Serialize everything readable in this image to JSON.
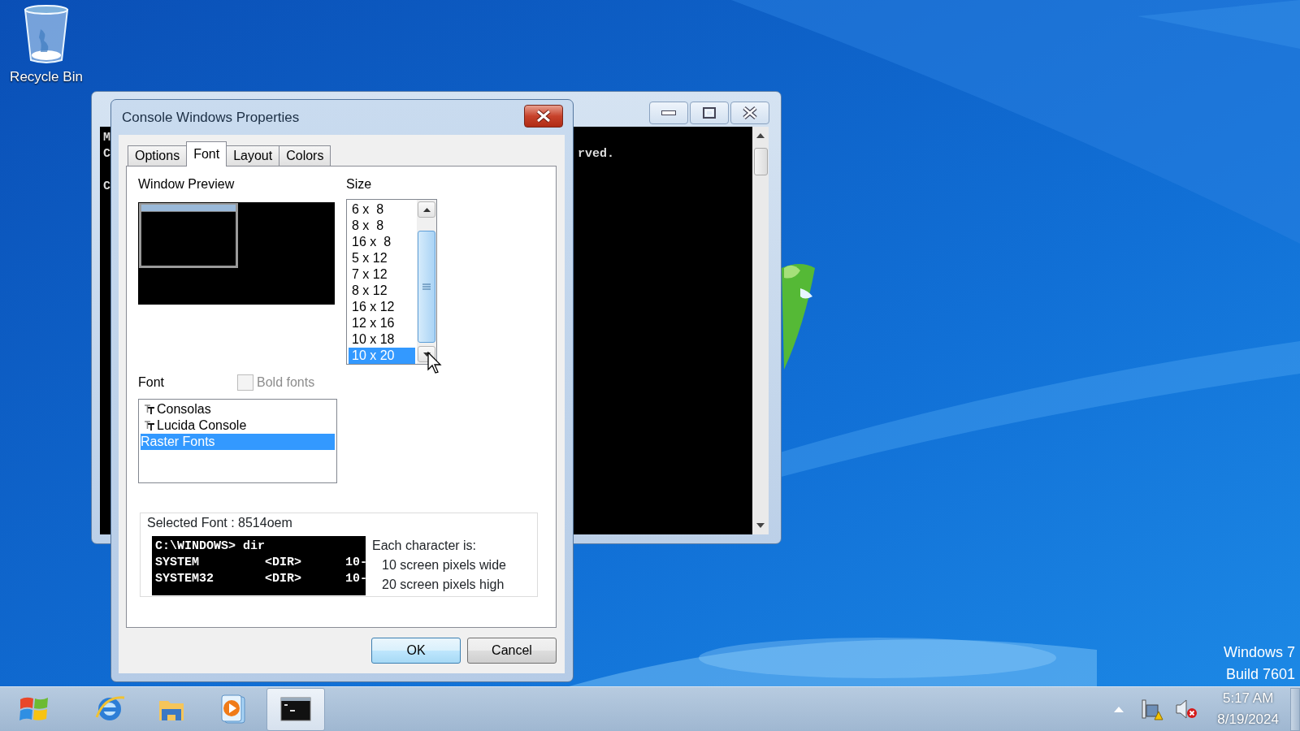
{
  "desktop": {
    "icons": [
      {
        "label": "Recycle Bin"
      }
    ],
    "os_label": [
      "Windows 7",
      "Build 7601"
    ]
  },
  "console_window": {
    "lines": [
      {
        "left": "M"
      },
      {
        "left": "C",
        "right": "rved."
      },
      {
        "blank": true
      },
      {
        "left": "C"
      }
    ]
  },
  "dialog": {
    "title": "Console Windows Properties",
    "tabs": [
      {
        "label": "Options",
        "selected": false
      },
      {
        "label": "Font",
        "selected": true
      },
      {
        "label": "Layout",
        "selected": false
      },
      {
        "label": "Colors",
        "selected": false
      }
    ],
    "window_preview": {
      "label": "Window Preview"
    },
    "size": {
      "label": "Size",
      "items": [
        {
          "label": "6 x  8",
          "selected": false
        },
        {
          "label": "8 x  8",
          "selected": false
        },
        {
          "label": "16 x  8",
          "selected": false
        },
        {
          "label": "5 x 12",
          "selected": false
        },
        {
          "label": "7 x 12",
          "selected": false
        },
        {
          "label": "8 x 12",
          "selected": false
        },
        {
          "label": "16 x 12",
          "selected": false
        },
        {
          "label": "12 x 16",
          "selected": false
        },
        {
          "label": "10 x 18",
          "selected": false
        },
        {
          "label": "10 x 20",
          "selected": true
        }
      ]
    },
    "font": {
      "label": "Font",
      "bold_fonts": {
        "label": "Bold fonts",
        "checked": false,
        "disabled": true
      },
      "items": [
        {
          "label": "Consolas",
          "kind": "truetype",
          "selected": false
        },
        {
          "label": "Lucida Console",
          "kind": "truetype",
          "selected": false
        },
        {
          "label": "Raster Fonts",
          "kind": "raster",
          "selected": true
        }
      ]
    },
    "selected_font": {
      "label": "Selected Font : 8514oem",
      "preview_lines": [
        "C:\\WINDOWS> dir",
        "SYSTEM         <DIR>      10-",
        "SYSTEM32       <DIR>      10-"
      ],
      "info_title": "Each character is:",
      "info_lines": [
        "10 screen pixels wide",
        "20 screen pixels high"
      ]
    },
    "buttons": [
      {
        "label": "OK",
        "default": true
      },
      {
        "label": "Cancel",
        "default": false
      }
    ]
  },
  "taskbar": {
    "apps": [
      {
        "kind": "browser",
        "selected": false
      },
      {
        "kind": "folder",
        "selected": false
      },
      {
        "kind": "media",
        "selected": false
      },
      {
        "kind": "console",
        "selected": true
      }
    ],
    "clock": {
      "time": "5:17 AM",
      "date": "8/19/2024"
    }
  }
}
